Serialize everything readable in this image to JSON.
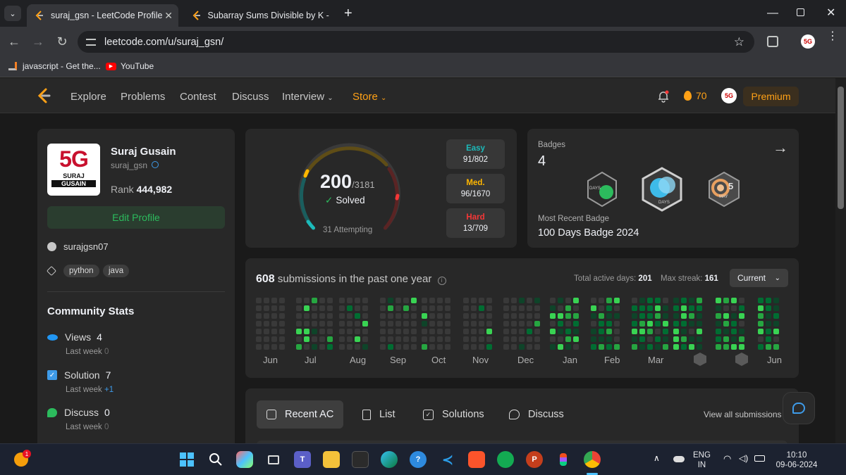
{
  "browser": {
    "tabs": [
      {
        "title": "suraj_gsn - LeetCode Profile",
        "active": true
      },
      {
        "title": "Subarray Sums Divisible by K - I",
        "active": false
      }
    ],
    "url": "leetcode.com/u/suraj_gsn/",
    "bookmarks": [
      "javascript - Get the...",
      "YouTube"
    ]
  },
  "nav": {
    "links": [
      "Explore",
      "Problems",
      "Contest",
      "Discuss",
      "Interview",
      "Store"
    ],
    "streak": "70",
    "premium": "Premium"
  },
  "profile": {
    "avatar_text": "5G",
    "avatar_sub1": "SURAJ",
    "avatar_sub2": "GUSAIN",
    "name": "Suraj Gusain",
    "username": "suraj_gsn",
    "rank_label": "Rank",
    "rank": "444,982",
    "edit_profile": "Edit Profile",
    "github": "surajgsn07",
    "skills": [
      "python",
      "java"
    ]
  },
  "community": {
    "title": "Community Stats",
    "last_week_label": "Last week",
    "items": [
      {
        "label": "Views",
        "value": "4",
        "delta": "0",
        "color": "#2196f3"
      },
      {
        "label": "Solution",
        "value": "7",
        "delta": "+1",
        "color": "#3e9be9"
      },
      {
        "label": "Discuss",
        "value": "0",
        "delta": "0",
        "color": "#2cbb5d"
      }
    ]
  },
  "solved": {
    "solved": "200",
    "total": "/3181",
    "solved_label": "Solved",
    "attempting": "31 Attempting",
    "easy_label": "Easy",
    "easy": "91/802",
    "easy_color": "#1cbaba",
    "medium_label": "Med.",
    "medium": "96/1670",
    "medium_color": "#ffb700",
    "hard_label": "Hard",
    "hard": "13/709",
    "hard_color": "#f63737"
  },
  "badges": {
    "title": "Badges",
    "count": "4",
    "recent_label": "Most Recent Badge",
    "recent": "100 Days Badge 2024",
    "b1_text": "DAYS",
    "b2_text": "DAYS",
    "b3_num": "5",
    "b3_text": "MAY"
  },
  "heatmap": {
    "count": "608",
    "title_suffix": "submissions in the past one year",
    "active_label": "Total active days:",
    "active_days": "201",
    "streak_label": "Max streak:",
    "max_streak": "161",
    "select": "Current",
    "months": [
      "Jun",
      "Jul",
      "Aug",
      "Sep",
      "Oct",
      "Nov",
      "Dec",
      "Jan",
      "Feb",
      "Mar",
      "",
      "",
      "Jun"
    ]
  },
  "recent": {
    "tabs": [
      "Recent AC",
      "List",
      "Solutions",
      "Discuss"
    ],
    "view_all": "View all submissions"
  },
  "taskbar": {
    "notif": "1",
    "lang1": "ENG",
    "lang2": "IN",
    "time": "10:10",
    "date": "09-06-2024"
  }
}
